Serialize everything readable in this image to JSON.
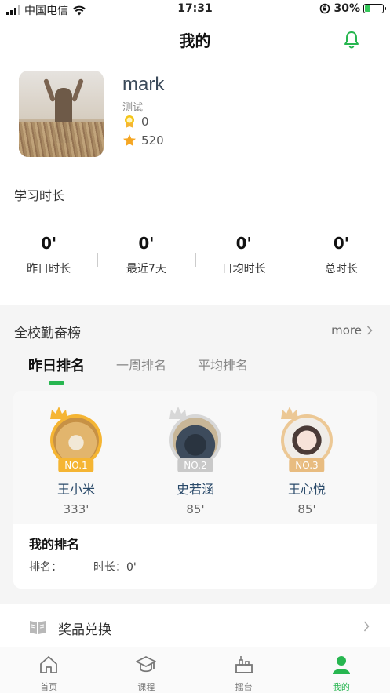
{
  "status_bar": {
    "carrier": "中国电信",
    "time": "17:31",
    "battery_percent": "30%",
    "battery_level": 0.3,
    "icons": [
      "signal-icon",
      "wifi-icon",
      "orientation-lock-icon",
      "battery-icon"
    ]
  },
  "nav": {
    "title": "我的",
    "bell_icon": "bell-icon"
  },
  "profile": {
    "name": "mark",
    "subtitle": "测试",
    "medal_count": "0",
    "star_count": "520"
  },
  "study": {
    "section_title": "学习时长",
    "stats": [
      {
        "value": "0'",
        "label": "昨日时长"
      },
      {
        "value": "0'",
        "label": "最近7天"
      },
      {
        "value": "0'",
        "label": "日均时长"
      },
      {
        "value": "0'",
        "label": "总时长"
      }
    ]
  },
  "board": {
    "title": "全校勤奋榜",
    "more": "more",
    "tabs": [
      {
        "label": "昨日排名",
        "active": true
      },
      {
        "label": "一周排名",
        "active": false
      },
      {
        "label": "平均排名",
        "active": false
      }
    ],
    "top": [
      {
        "badge": "NO.1",
        "name": "王小米",
        "minutes": "333'"
      },
      {
        "badge": "NO.2",
        "name": "史若涵",
        "minutes": "85'"
      },
      {
        "badge": "NO.3",
        "name": "王心悦",
        "minutes": "85'"
      }
    ],
    "my_rank": {
      "title": "我的排名",
      "rank_label": "排名：",
      "time_label": "时长：0'"
    }
  },
  "exchange": {
    "label": "奖品兑换"
  },
  "tabbar": {
    "items": [
      {
        "label": "首页",
        "icon": "home-icon",
        "active": false
      },
      {
        "label": "课程",
        "icon": "course-cap-icon",
        "active": false
      },
      {
        "label": "擂台",
        "icon": "arena-icon",
        "active": false
      },
      {
        "label": "我的",
        "icon": "profile-icon",
        "active": true
      }
    ]
  },
  "colors": {
    "accent_green": "#27b650",
    "gold": "#f5b533",
    "silver": "#d7d7d7",
    "bronze": "#ecc895"
  }
}
